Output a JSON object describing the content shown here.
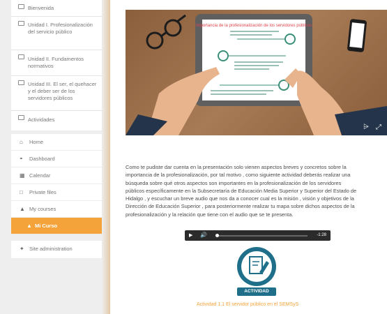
{
  "sidebar": {
    "sections": [
      {
        "label": "Bienvenida"
      },
      {
        "label": "Unidad I. Profesionalización del servicio público"
      },
      {
        "label": "Unidad II. Fundamentos normativos"
      },
      {
        "label": "Unidad III. El ser, el quehacer y el deber ser de los servidores públicos"
      },
      {
        "label": "Actividades"
      }
    ],
    "nav": [
      {
        "label": "Home"
      },
      {
        "label": "Dashboard"
      },
      {
        "label": "Calendar"
      },
      {
        "label": "Private files"
      },
      {
        "label": "My courses"
      },
      {
        "label": "Mi Curso"
      }
    ],
    "admin": {
      "label": "Site administration"
    }
  },
  "video": {
    "slide_title": "Importancia de la profesionalización de los servidores públicos",
    "share_icon": "share-icon",
    "fullscreen_icon": "fullscreen-icon",
    "colors": {
      "slide_title": "#e0424a",
      "accent": "#3a8f78",
      "table": "#8b5e3c"
    }
  },
  "content": {
    "paragraph_lines": [
      "Como te pudiste dar cuenta en la presentación solo vienen aspectos breves y concretos sobre la",
      "importancia de la profesionalización, por tal motivo , como siguiente actividad deberás realizar una",
      "búsqueda sobre qué otros aspectos son importantes en la profesionalización de los servidores",
      "públicos específicamente en la Subsecretaría de Educación Media Superior y Superior del Estado de",
      "Hidalgo , y escuchar un breve audio que nos da a conocer cual es la misión , visión y objetivos de la",
      "Dirección de Educación Superior ,  para posteriormente realizar tu mapa sobre dichos aspectos de la",
      "profesionalización y la relación que tiene con el audio que se te presenta."
    ]
  },
  "audio": {
    "time": "-1:28"
  },
  "activity": {
    "badge_label": "ACTIVIDAD",
    "caption": "Actividad 1.1 El servidor público en el SEMSyS",
    "colors": {
      "badge": "#1f6f8b",
      "caption": "#f4a33a"
    }
  },
  "theme": {
    "active_nav": "#f4a33a"
  }
}
